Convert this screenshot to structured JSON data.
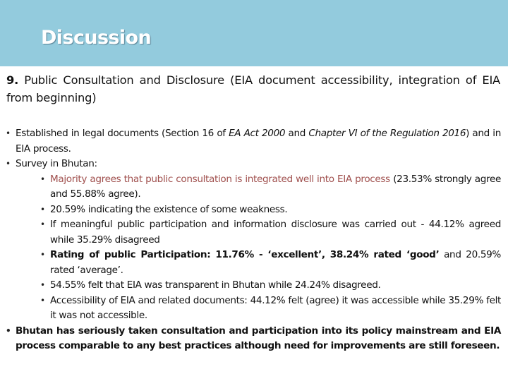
{
  "slide": {
    "title": "Discussion",
    "header_color": "#93CBDD",
    "accent_text_color": "#A0504E"
  },
  "heading": {
    "number": "9.",
    "text": "Public Consultation and Disclosure (EIA document accessibility, integration of EIA from beginning)"
  },
  "bullets": {
    "established": {
      "part1": "Established in legal documents (Section 16 of ",
      "act": "EA Act 2000",
      "part2": " and ",
      "chapter": "Chapter VI of the Regulation 2016",
      "part3": ") and in EIA process."
    },
    "survey": {
      "label": "Survey in Bhutan:",
      "items": [
        {
          "highlight": "Majority agrees that public consultation is integrated well into EIA process",
          "rest": " (23.53% strongly agree and 55.88% agree)."
        },
        {
          "text": "20.59% indicating the existence of some weakness."
        },
        {
          "text": "If meaningful public participation and information disclosure was carried out - 44.12% agreed while 35.29% disagreed"
        },
        {
          "bold1": "Rating of public Participation: 11.76% - ‘excellent’, 38.24% rated ‘good’",
          "rest": " and 20.59% rated ‘average’."
        },
        {
          "text": "54.55% felt that EIA was transparent in Bhutan while 24.24% disagreed."
        },
        {
          "text": "Accessibility of EIA and related documents: 44.12% felt (agree) it was accessible while 35.29% felt it was not accessible."
        }
      ]
    },
    "conclusion": {
      "text": "Bhutan has seriously taken consultation and participation into its policy mainstream and EIA process comparable to any best practices although need for improvements are still foreseen."
    }
  },
  "icons": {
    "bullet": "•"
  }
}
